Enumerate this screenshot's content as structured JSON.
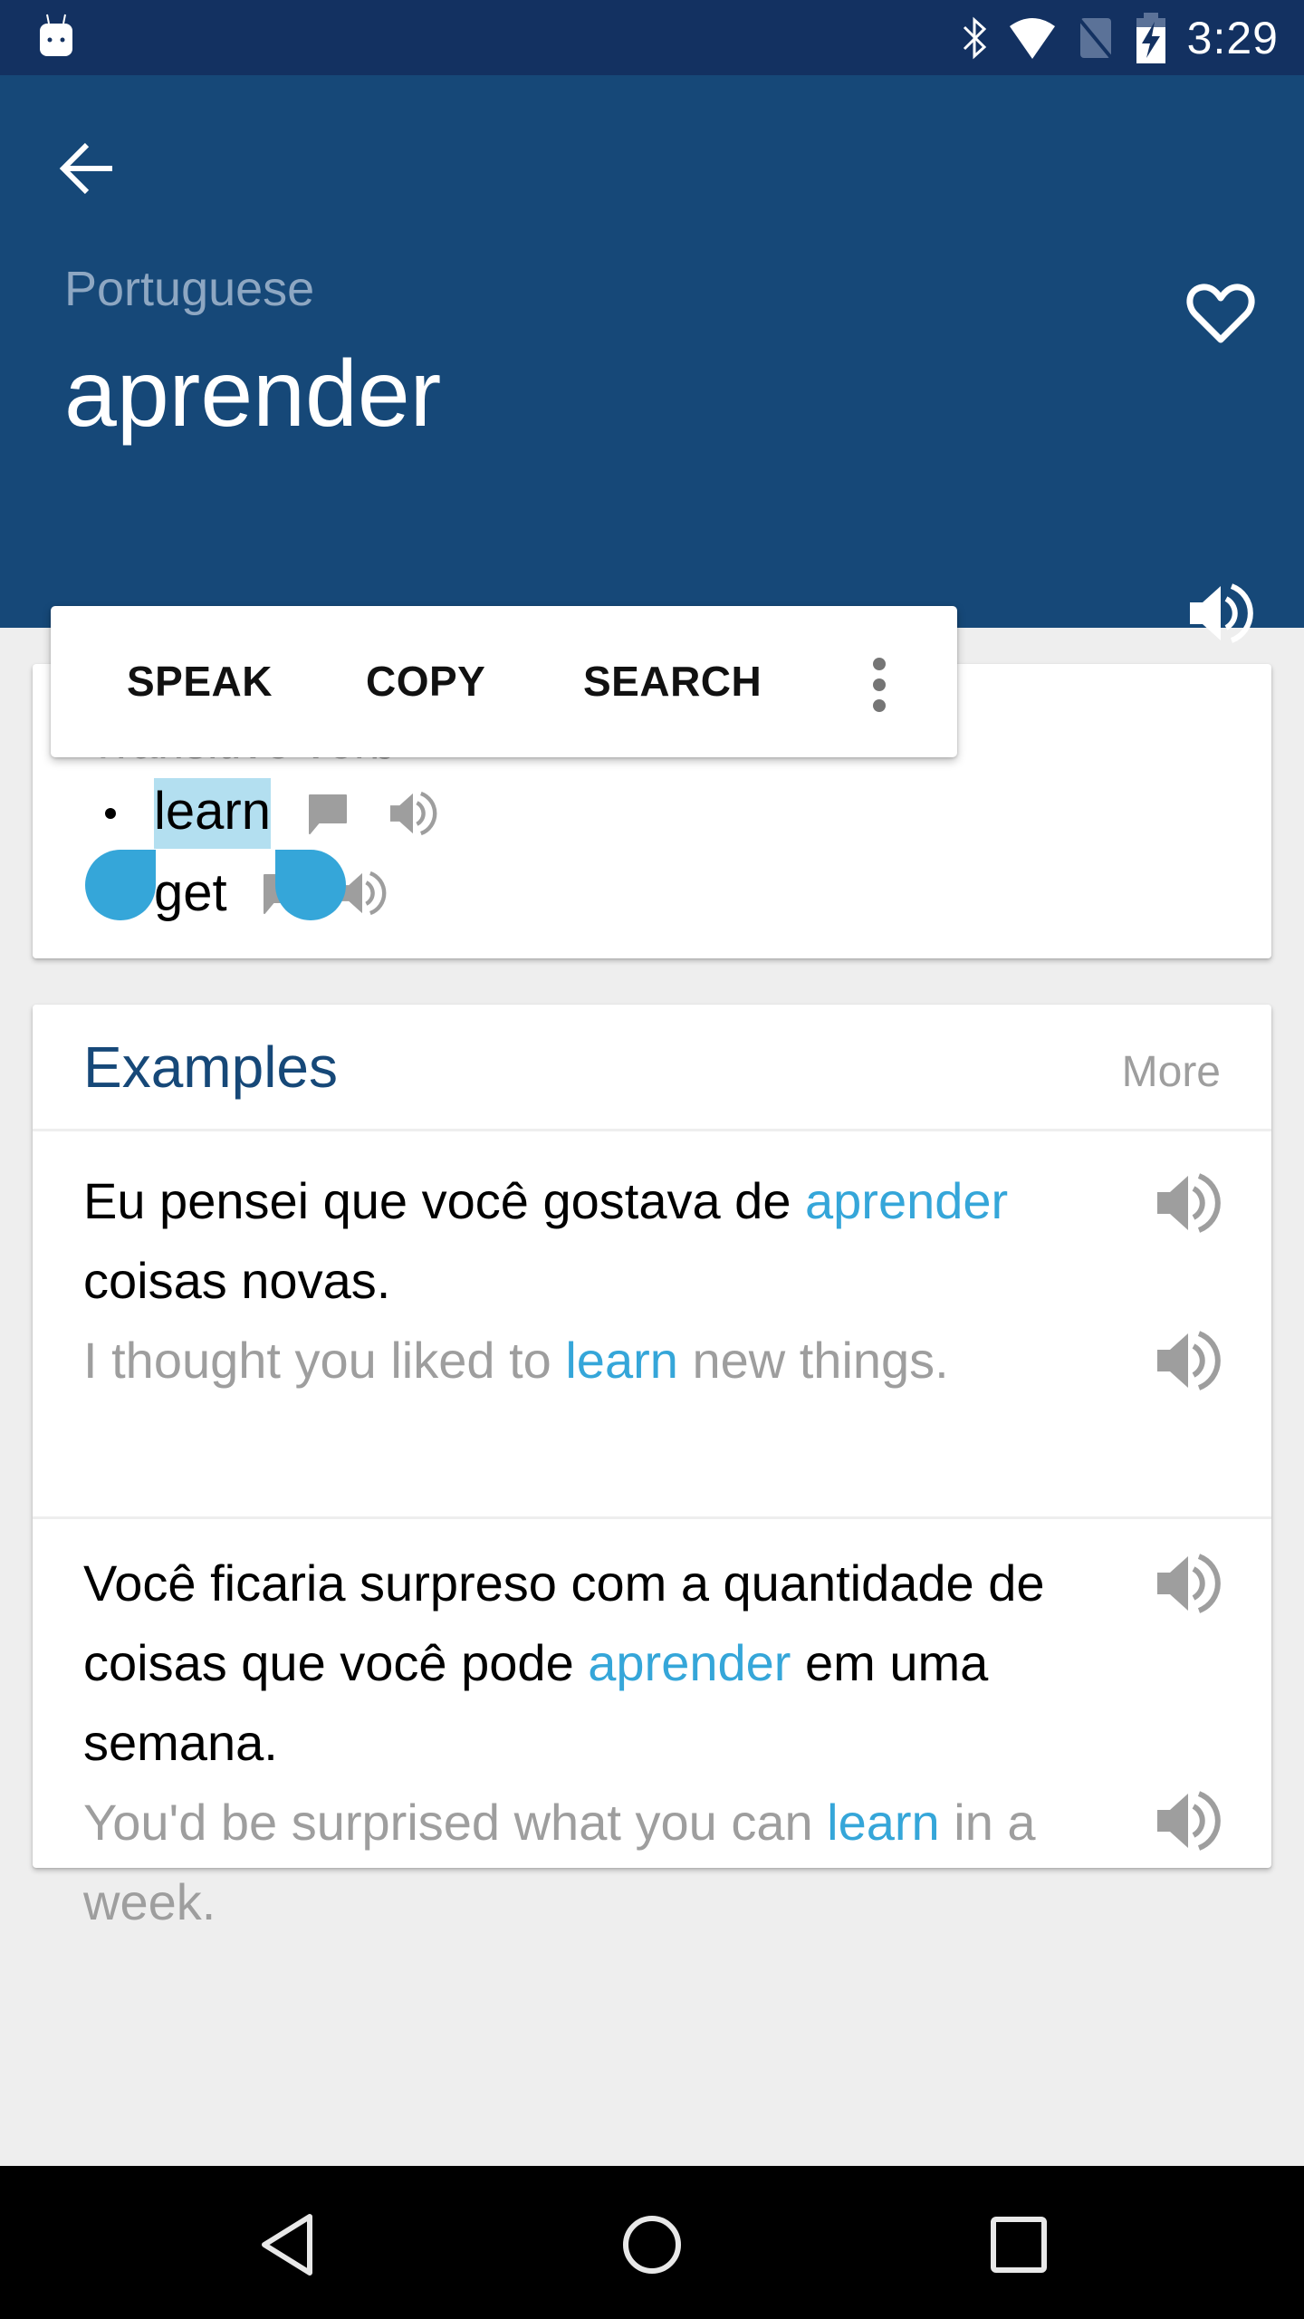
{
  "status_bar": {
    "time": "3:29",
    "icons": [
      "android-notification-icon",
      "bluetooth-icon",
      "wifi-icon",
      "no-sim-icon",
      "battery-charging-icon"
    ]
  },
  "header": {
    "language": "Portuguese",
    "headword": "aprender",
    "icons": [
      "back-arrow-icon",
      "heart-outline-icon",
      "speaker-icon"
    ]
  },
  "translations": {
    "part_of_speech": "Transitive verb",
    "items": [
      {
        "word": "learn",
        "selected": true
      },
      {
        "word": "get",
        "selected": false
      }
    ]
  },
  "text_selection_popup": {
    "actions": [
      "SPEAK",
      "COPY",
      "SEARCH"
    ],
    "more_icon": "more-vert-icon"
  },
  "examples": {
    "title": "Examples",
    "more_label": "More",
    "items": [
      {
        "source_parts": [
          "Eu pensei que você gostava de ",
          "aprender",
          " coisas novas."
        ],
        "translation_parts": [
          "I thought you liked to ",
          "learn",
          " new things."
        ]
      },
      {
        "source_parts": [
          "Você ficaria surpreso com a quantidade de coisas que você pode ",
          "aprender",
          " em uma semana."
        ],
        "translation_parts": [
          "You'd be surprised what you can ",
          "learn",
          " in a week."
        ]
      }
    ]
  },
  "colors": {
    "status_bar": "#133161",
    "header": "#164878",
    "highlight": "#35a6d9",
    "selection": "#b3dff0",
    "secondary_text": "#9e9e9e",
    "background": "#eeeeee"
  },
  "nav_bar": {
    "buttons": [
      "back-triangle-icon",
      "home-circle-icon",
      "recents-square-icon"
    ]
  }
}
